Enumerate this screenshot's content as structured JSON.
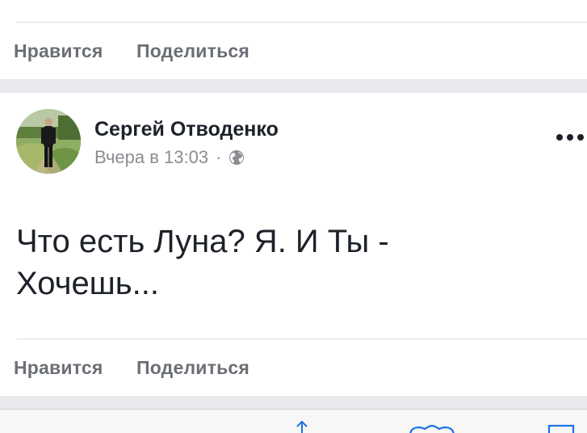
{
  "previous_post": {
    "like_label": "Нравится",
    "share_label": "Поделиться"
  },
  "post": {
    "author": "Сергей Отводенко",
    "timestamp": "Вчера в 13:03",
    "separator": "·",
    "privacy_icon": "globe-icon",
    "more_icon": "more-horizontal-icon",
    "text_line1": "Что есть Луна? Я. И Ты -",
    "text_line2": "Хочешь...",
    "like_label": "Нравится",
    "share_label": "Поделиться"
  },
  "browser_toolbar": {
    "icons": [
      "share-icon",
      "bookmarks-icon",
      "tabs-icon"
    ]
  },
  "colors": {
    "text": "#1d2129",
    "secondary_text": "#8a8d91",
    "action_text": "#6b6f75",
    "separator_band": "#e9eaed"
  }
}
